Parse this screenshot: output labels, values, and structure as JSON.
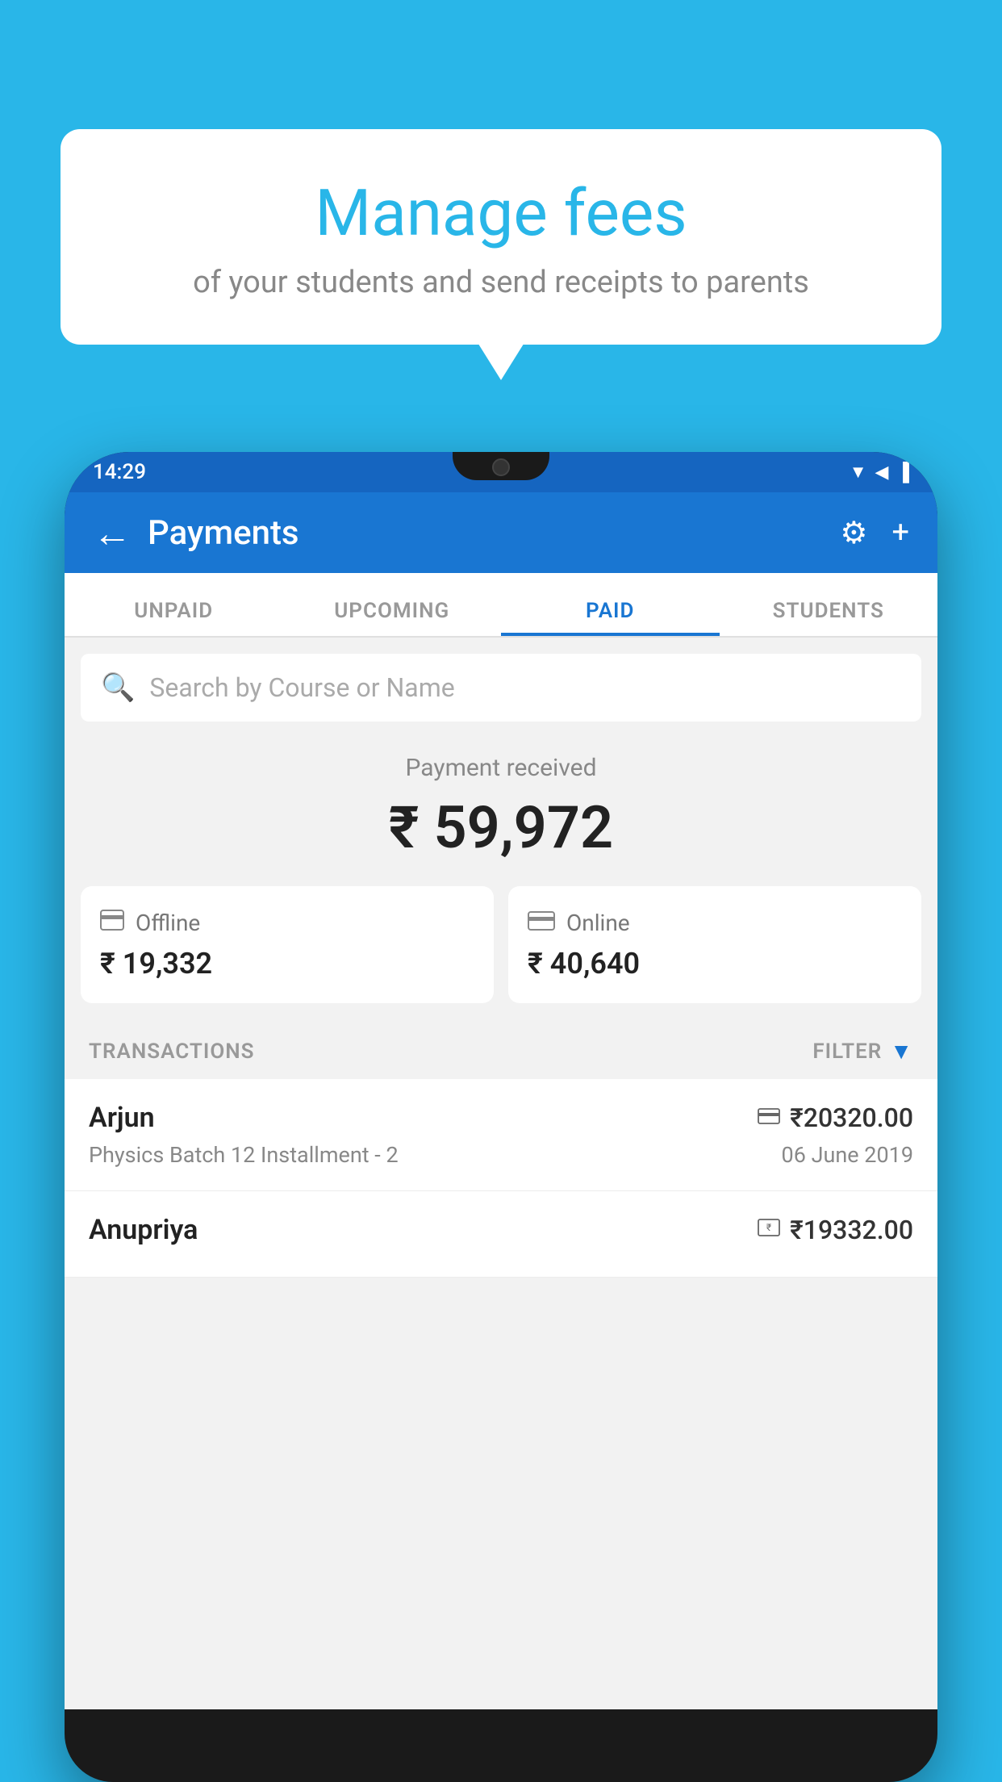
{
  "background_color": "#29b6e8",
  "bubble": {
    "title": "Manage fees",
    "subtitle": "of your students and send receipts to parents"
  },
  "phone": {
    "status_bar": {
      "time": "14:29",
      "icons": [
        "▼",
        "◀",
        "▐"
      ]
    },
    "header": {
      "back_label": "←",
      "title": "Payments",
      "settings_icon": "⚙",
      "add_icon": "+"
    },
    "tabs": [
      {
        "label": "UNPAID",
        "active": false
      },
      {
        "label": "UPCOMING",
        "active": false
      },
      {
        "label": "PAID",
        "active": true
      },
      {
        "label": "STUDENTS",
        "active": false
      }
    ],
    "search": {
      "placeholder": "Search by Course or Name"
    },
    "payment_summary": {
      "label": "Payment received",
      "amount": "₹ 59,972"
    },
    "payment_cards": [
      {
        "icon": "offline",
        "label": "Offline",
        "amount": "₹ 19,332"
      },
      {
        "icon": "online",
        "label": "Online",
        "amount": "₹ 40,640"
      }
    ],
    "transactions_label": "TRANSACTIONS",
    "filter_label": "FILTER",
    "transactions": [
      {
        "name": "Arjun",
        "payment_type": "online",
        "amount": "₹20320.00",
        "course": "Physics Batch 12 Installment - 2",
        "date": "06 June 2019"
      },
      {
        "name": "Anupriya",
        "payment_type": "offline",
        "amount": "₹19332.00",
        "course": "",
        "date": ""
      }
    ]
  }
}
